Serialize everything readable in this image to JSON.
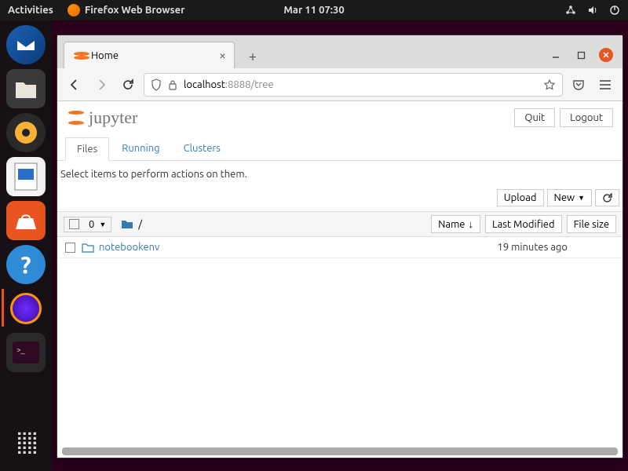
{
  "gnome": {
    "activities": "Activities",
    "app_label": "Firefox Web Browser",
    "clock": "Mar 11  07:30"
  },
  "browser": {
    "tab_title": "Home",
    "url_host": "localhost",
    "url_port_path": ":8888/tree"
  },
  "jupyter": {
    "brand": "jupyter",
    "quit": "Quit",
    "logout": "Logout",
    "tabs": {
      "files": "Files",
      "running": "Running",
      "clusters": "Clusters"
    },
    "hint": "Select items to perform actions on them.",
    "upload": "Upload",
    "new": "New",
    "selected_count": "0",
    "breadcrumb_sep": "/",
    "cols": {
      "name": "Name",
      "modified": "Last Modified",
      "size": "File size"
    },
    "rows": [
      {
        "name": "notebookenv",
        "modified": "19 minutes ago"
      }
    ]
  }
}
